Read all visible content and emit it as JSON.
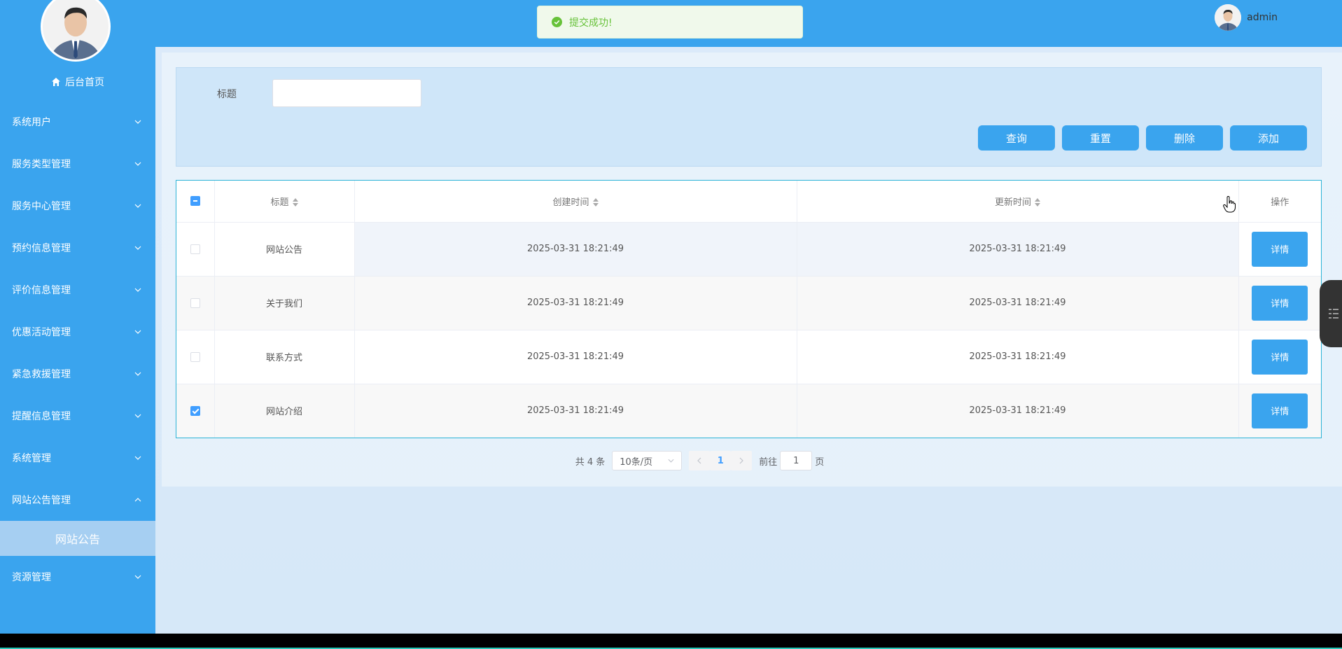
{
  "sidebar": {
    "home_label": "后台首页",
    "items": [
      {
        "label": "系统用户"
      },
      {
        "label": "服务类型管理"
      },
      {
        "label": "服务中心管理"
      },
      {
        "label": "预约信息管理"
      },
      {
        "label": "评价信息管理"
      },
      {
        "label": "优惠活动管理"
      },
      {
        "label": "紧急救援管理"
      },
      {
        "label": "提醒信息管理"
      },
      {
        "label": "系统管理"
      },
      {
        "label": "网站公告管理",
        "expanded": true
      },
      {
        "label": "资源管理"
      }
    ],
    "active_sub_item": "网站公告"
  },
  "header": {
    "username": "admin",
    "toast": "提交成功!"
  },
  "search": {
    "title_label": "标题",
    "title_value": "",
    "buttons": {
      "query": "查询",
      "reset": "重置",
      "delete": "删除",
      "add": "添加"
    }
  },
  "table": {
    "columns": {
      "title": "标题",
      "created": "创建时间",
      "updated": "更新时间",
      "actions": "操作"
    },
    "detail_label": "详情",
    "rows": [
      {
        "checked": false,
        "title": "网站公告",
        "created": "2025-03-31 18:21:49",
        "updated": "2025-03-31 18:21:49"
      },
      {
        "checked": false,
        "title": "关于我们",
        "created": "2025-03-31 18:21:49",
        "updated": "2025-03-31 18:21:49"
      },
      {
        "checked": false,
        "title": "联系方式",
        "created": "2025-03-31 18:21:49",
        "updated": "2025-03-31 18:21:49"
      },
      {
        "checked": true,
        "title": "网站介绍",
        "created": "2025-03-31 18:21:49",
        "updated": "2025-03-31 18:21:49"
      }
    ]
  },
  "pagination": {
    "total_text": "共 4 条",
    "page_size": "10条/页",
    "current_page": "1",
    "goto_prefix": "前往",
    "goto_value": "1",
    "goto_suffix": "页"
  },
  "colors": {
    "primary": "#3aa4ee",
    "success": "#67c23a"
  }
}
